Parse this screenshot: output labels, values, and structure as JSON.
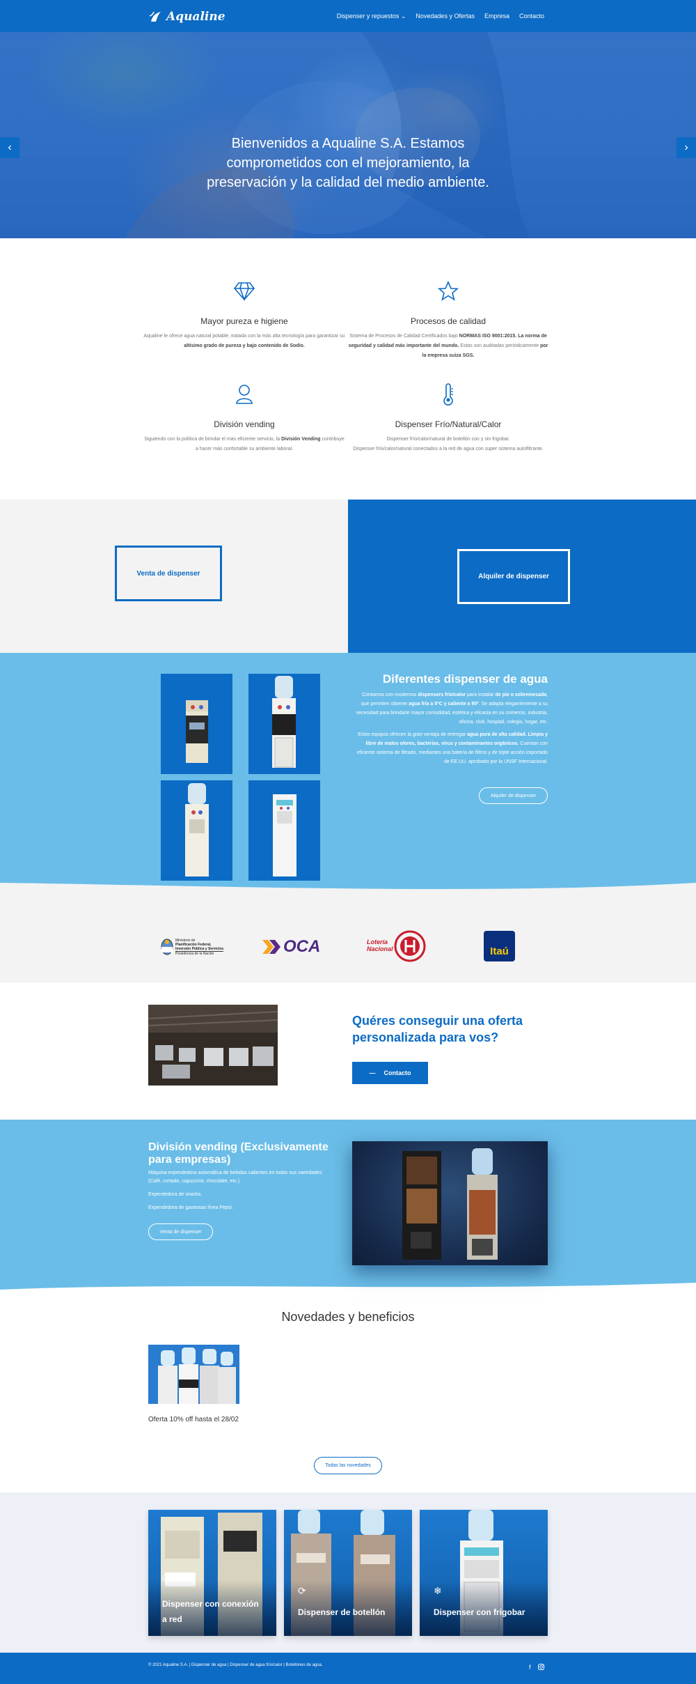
{
  "brand": {
    "name": "Aqualine",
    "accent": "#0c6bc4",
    "light_blue": "#6abde8"
  },
  "nav": {
    "items": [
      "Dispenser y repuestos",
      "Novedades y Ofertas",
      "Empresa",
      "Contacto"
    ],
    "dropdown_icon": "chevron-down-icon"
  },
  "hero": {
    "text": "Bienvenidos a Aqualine S.A. Estamos comprometidos con el mejoramiento, la preservación y la calidad del medio ambiente.",
    "prev_icon": "chevron-left-icon",
    "next_icon": "chevron-right-icon"
  },
  "features": [
    {
      "icon": "diamond-icon",
      "title": "Mayor pureza e higiene",
      "desc_a": "Aqualine le ofrece agua natural potable, tratada con la más alta tecnología para garantizar su ",
      "desc_b": "altísimo grado de pureza y bajo contenido de Sodio."
    },
    {
      "icon": "star-icon",
      "title": "Procesos de calidad",
      "desc_a": "Sistema de Procesos de Calidad Certificados bajo ",
      "desc_b": "NORMAS ISO 9001:2015. La norma de seguridad y calidad más importante del mundo.",
      "desc_c": " Estas son auditadas periódicamente ",
      "desc_d": "por la empresa suiza SGS."
    },
    {
      "icon": "user-icon",
      "title": "División vending",
      "desc_a": "Siguiendo con la política de brindar el más eficiente servicio, la ",
      "desc_b": "División Vending",
      "desc_c": " contribuye a hacer más confortable su ambiente laboral."
    },
    {
      "icon": "thermometer-icon",
      "title": "Dispenser Frío/Natural/Calor",
      "desc_a": "Dispenser frío/calor/natural de botellón con y sin frigobar.",
      "desc_b": "Dispenser frío/calor/natural conectados a la red de agua con super sistema autofiltrante."
    }
  ],
  "sale_rent": {
    "sale_label": "Venta de dispenser",
    "rent_label": "Alquiler de dispenser"
  },
  "dispensers": {
    "title": "Diferentes dispenser de agua",
    "p1_a": "Contamos con modernos ",
    "p1_b": "dispensers frío/calor",
    "p1_c": " para instalar ",
    "p1_d": "de pie o sobremesada",
    "p1_e": ", que permiten obtener ",
    "p1_f": "agua fría a 5ºC y caliente a 90º",
    "p1_g": ". Se adapta elegantemente a su necesidad para brindarle mayor comodidad, estética y eficacia en su comercio, industria, oficina, club, hospital, colegio, hogar, etc.",
    "p2_a": "Estos equipos ofrecen la gran ventaja de entregar ",
    "p2_b": "agua pura de alta calidad. Limpia y libre de malos olores, bacterias, virus y contaminantes orgánicos.",
    "p2_c": " Cuentan con eficiente sistema de filtrado, mediantes una batería de filtros y de triple acción importado de EE.UU. aprobado por la UNSF Internacional.",
    "button": "Alquiler de dispenser"
  },
  "partners": {
    "minist_line1": "Ministerio de",
    "minist_line2": "Planificación Federal,",
    "minist_line3": "Inversión Pública y Servicios",
    "minist_line4": "Presidencia de la Nación",
    "oca": "OCA",
    "loteria_line1": "Lotería",
    "loteria_line2": "Nacional",
    "itau": "Itaú"
  },
  "contact": {
    "title": "Quéres conseguir una oferta personalizada para vos?",
    "button": "Contacto"
  },
  "vending": {
    "title": "División vending (Exclusivamente para empresas)",
    "p1": "Máquina expendedora automática de bebidas calientes en todas sus variedades (Café, cortado, capuccino, chocolate, etc.)",
    "p2": "Expendedora de snacks.",
    "p3": "Expendedora de gaseosas línea Pepsi.",
    "button": "Venta de dispenser"
  },
  "news": {
    "title": "Novedades y beneficios",
    "item_caption": "Oferta 10% off hasta el 28/02",
    "button": "Todas las novedades"
  },
  "cards": [
    {
      "icon": "target-icon",
      "label": "Dispenser con conexión a red"
    },
    {
      "icon": "refresh-icon",
      "label": "Dispenser de botellón"
    },
    {
      "icon": "snowflake-icon",
      "label": "Dispenser con frigobar"
    }
  ],
  "footer": {
    "text": "© 2021 Aqualine S.A. | Dispenser de agua | Dispenser de agua frío/calor | Botellones de agua.",
    "social": [
      "facebook-icon",
      "instagram-icon"
    ]
  }
}
